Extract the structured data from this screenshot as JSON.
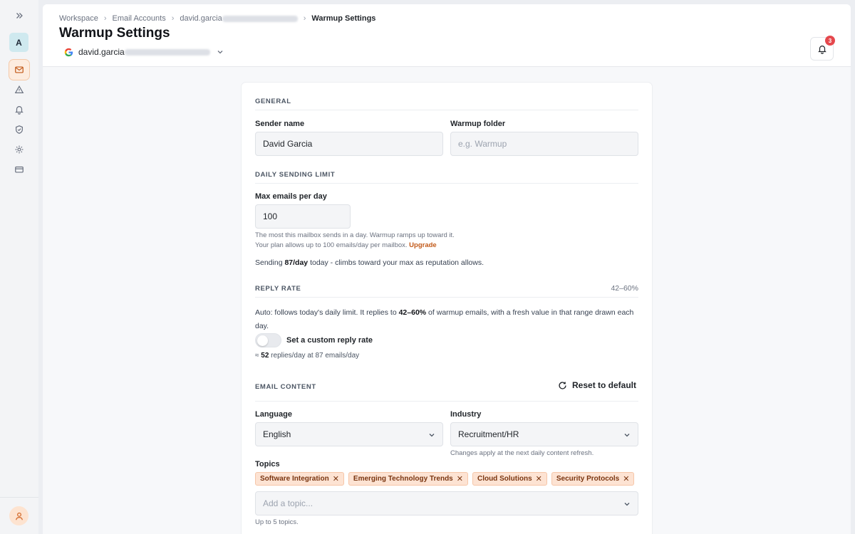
{
  "breadcrumb": {
    "items": [
      "Workspace",
      "Email Accounts",
      "david.garcia"
    ],
    "current": "Warmup Settings"
  },
  "page_title": "Warmup Settings",
  "account": {
    "email_prefix": "david.garcia"
  },
  "notifications": {
    "count": "3"
  },
  "sidebar": {
    "avatar_letter": "A"
  },
  "general": {
    "section_title": "GENERAL",
    "sender_name_label": "Sender name",
    "sender_name_value": "David Garcia",
    "warmup_folder_label": "Warmup folder",
    "warmup_folder_placeholder": "e.g. Warmup"
  },
  "daily_limit": {
    "section_title": "DAILY SENDING LIMIT",
    "max_label": "Max emails per day",
    "max_value": "100",
    "help_line1": "The most this mailbox sends in a day. Warmup ramps up toward it.",
    "help_line2": "Your plan allows up to 100 emails/day per mailbox.",
    "upgrade_link": "Upgrade",
    "sending_prefix": "Sending ",
    "sending_value": "87/day",
    "sending_suffix": " today - climbs toward your max as reputation allows."
  },
  "reply_rate": {
    "section_title": "REPLY RATE",
    "range_text": "42–60%",
    "desc_prefix": "Auto: follows today's daily limit. It replies to ",
    "desc_bold": "42–60%",
    "desc_suffix": " of warmup emails, with a fresh value in that range drawn each day.",
    "toggle_label": "Set a custom reply rate",
    "estimate_prefix": "≈ ",
    "estimate_value": "52",
    "estimate_suffix": " replies/day at 87 emails/day"
  },
  "email_content": {
    "section_title": "EMAIL CONTENT",
    "reset_label": "Reset to default",
    "language_label": "Language",
    "language_value": "English",
    "industry_label": "Industry",
    "industry_value": "Recruitment/HR",
    "industry_help": "Changes apply at the next daily content refresh.",
    "topics_label": "Topics",
    "topics": [
      "Software Integration",
      "Emerging Technology Trends",
      "Cloud Solutions",
      "Security Protocols"
    ],
    "topic_placeholder": "Add a topic...",
    "topics_help": "Up to 5 topics."
  },
  "colors": {
    "accent": "#c25a1a",
    "tag_bg": "#fde3d3",
    "badge": "#e5484d"
  }
}
